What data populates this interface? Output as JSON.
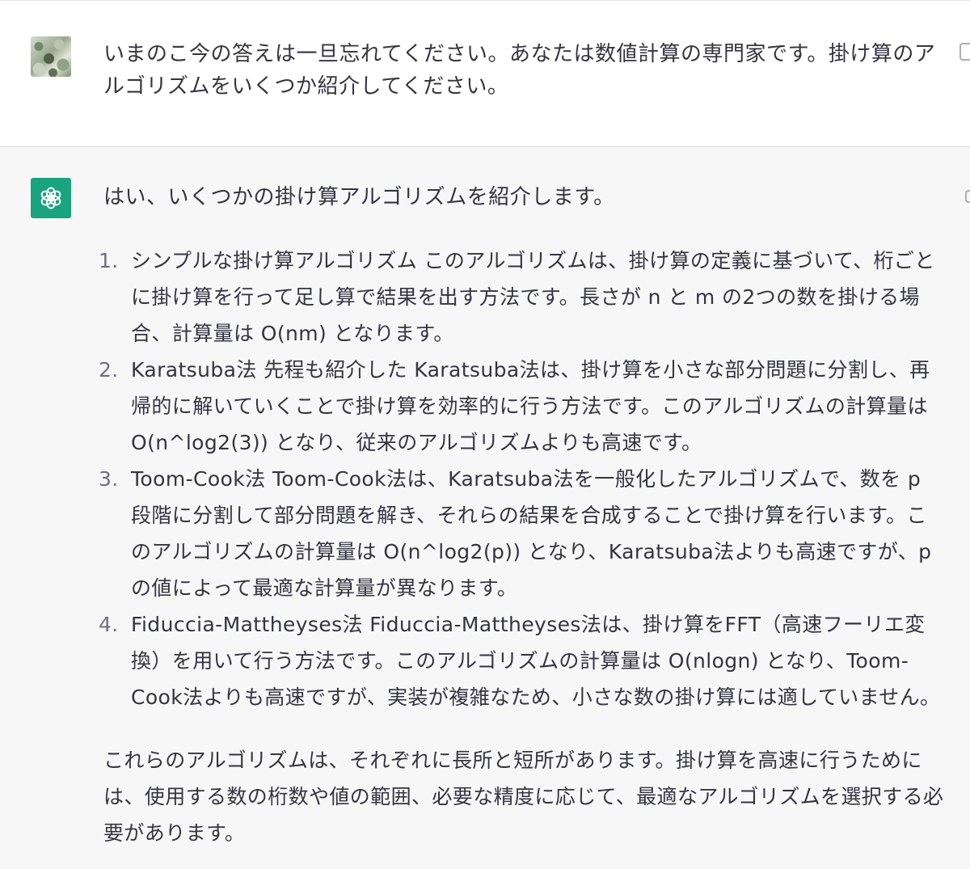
{
  "user_message": {
    "avatar": "identicon-avatar",
    "text": "いまのこ今の答えは一旦忘れてください。あなたは数値計算の専門家です。掛け算のアルゴリズムをいくつか紹介してください。",
    "edit_icon": "edit-icon"
  },
  "assistant_message": {
    "avatar": "openai-logo-icon",
    "accent_color": "#19a37f",
    "intro": "はい、いくつかの掛け算アルゴリズムを紹介します。",
    "items": [
      {
        "number": "1.",
        "text": "シンプルな掛け算アルゴリズム このアルゴリズムは、掛け算の定義に基づいて、桁ごとに掛け算を行って足し算で結果を出す方法です。長さが n と m の2つの数を掛ける場合、計算量は O(nm) となります。"
      },
      {
        "number": "2.",
        "text": "Karatsuba法 先程も紹介した Karatsuba法は、掛け算を小さな部分問題に分割し、再帰的に解いていくことで掛け算を効率的に行う方法です。このアルゴリズムの計算量は O(n^log2(3)) となり、従来のアルゴリズムよりも高速です。"
      },
      {
        "number": "3.",
        "text": "Toom-Cook法 Toom-Cook法は、Karatsuba法を一般化したアルゴリズムで、数を p 段階に分割して部分問題を解き、それらの結果を合成することで掛け算を行います。このアルゴリズムの計算量は O(n^log2(p)) となり、Karatsuba法よりも高速ですが、p の値によって最適な計算量が異なります。"
      },
      {
        "number": "4.",
        "text": "Fiduccia-Mattheyses法 Fiduccia-Mattheyses法は、掛け算をFFT（高速フーリエ変換）を用いて行う方法です。このアルゴリズムの計算量は O(nlogn) となり、Toom-Cook法よりも高速ですが、実装が複雑なため、小さな数の掛け算には適していません。"
      }
    ],
    "closing": "これらのアルゴリズムは、それぞれに長所と短所があります。掛け算を高速に行うためには、使用する数の桁数や値の範囲、必要な精度に応じて、最適なアルゴリズムを選択する必要があります。",
    "copy_icon": "copy-icon"
  }
}
